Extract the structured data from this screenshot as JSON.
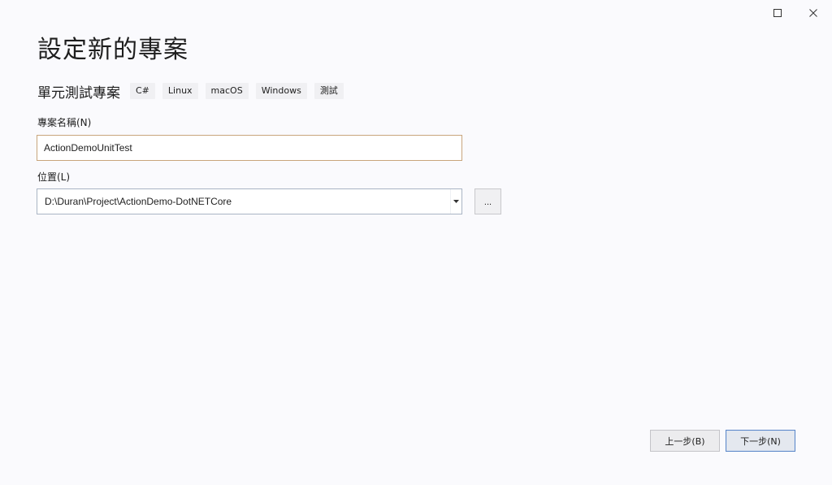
{
  "window": {
    "title": "設定新的專案"
  },
  "template": {
    "name": "單元測試專案",
    "tags": [
      "C#",
      "Linux",
      "macOS",
      "Windows",
      "測試"
    ]
  },
  "project_name": {
    "label": "專案名稱(N)",
    "value": "ActionDemoUnitTest"
  },
  "location": {
    "label": "位置(L)",
    "value": "D:\\Duran\\Project\\ActionDemo-DotNETCore",
    "browse_label": "..."
  },
  "footer": {
    "back_label": "上一步(B)",
    "next_label": "下一步(N)"
  },
  "icons": {
    "maximize": "maximize-icon",
    "close": "close-icon",
    "dropdown": "caret-down-icon"
  }
}
